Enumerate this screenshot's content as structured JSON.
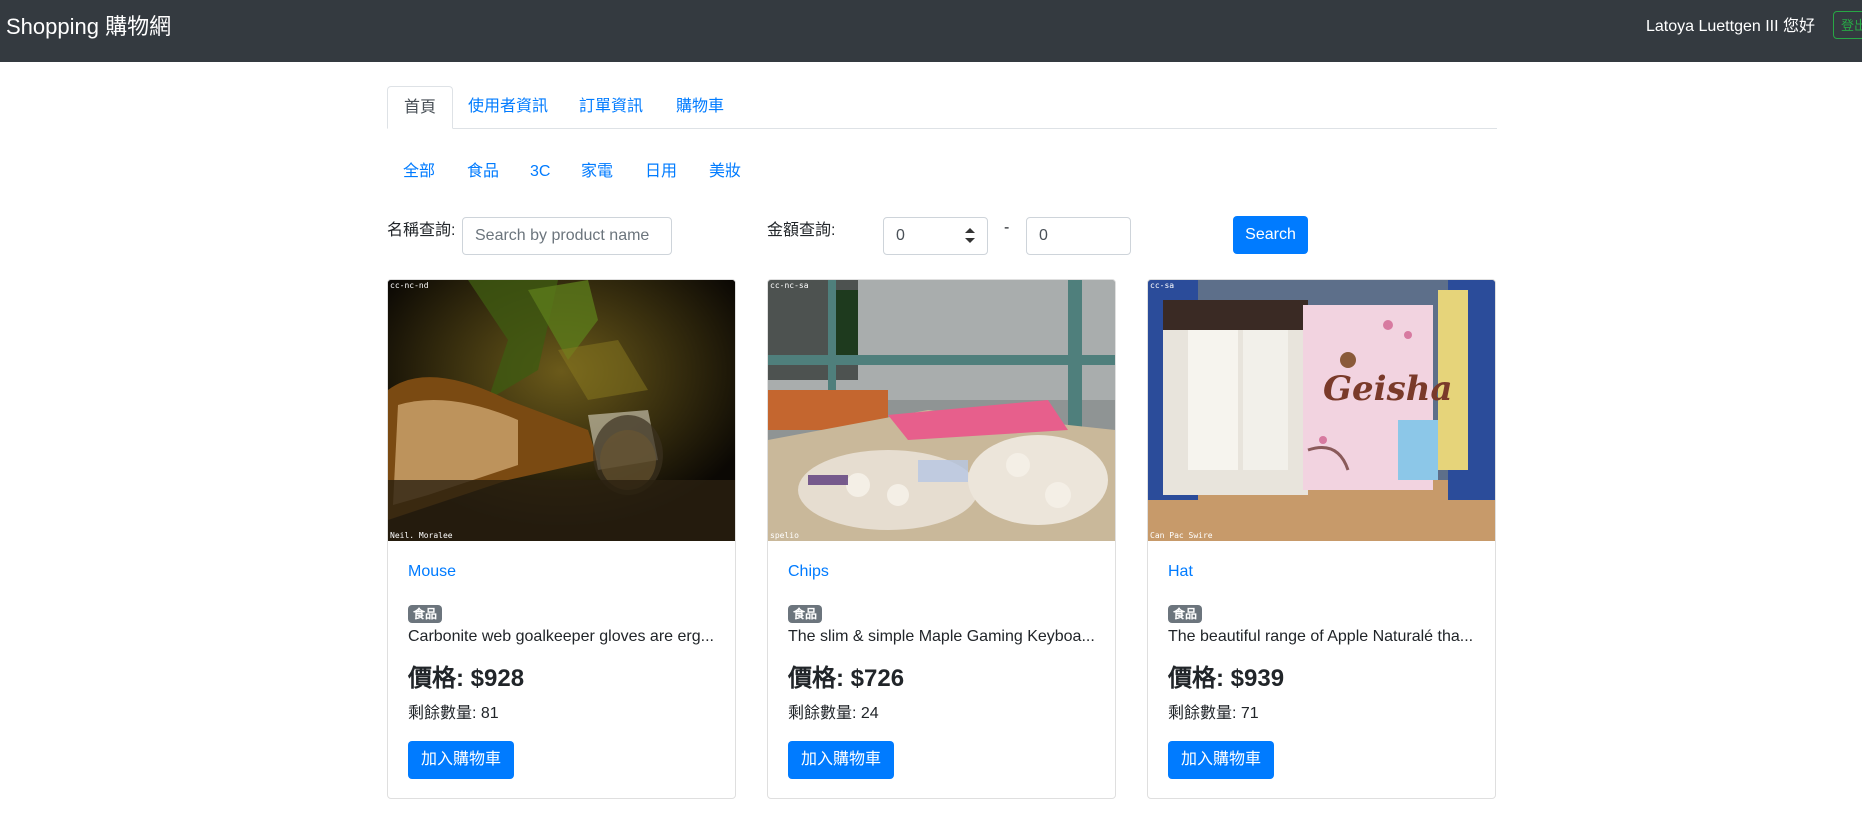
{
  "navbar": {
    "brand": "Shopping 購物網",
    "greeting": "Latoya Luettgen III 您好",
    "logout_label": "登出"
  },
  "tabs": [
    {
      "label": "首頁",
      "active": true
    },
    {
      "label": "使用者資訊",
      "active": false
    },
    {
      "label": "訂單資訊",
      "active": false
    },
    {
      "label": "購物車",
      "active": false
    }
  ],
  "categories": [
    "全部",
    "食品",
    "3C",
    "家電",
    "日用",
    "美妝"
  ],
  "search": {
    "name_label": "名稱查詢:",
    "name_placeholder": "Search by product name",
    "price_label": "金額查詢:",
    "min_value": "0",
    "separator": "-",
    "max_value": "0",
    "button_label": "Search"
  },
  "products": [
    {
      "name": "Mouse",
      "category": "食品",
      "description": "Carbonite web goalkeeper gloves are erg...",
      "price": "價格: $928",
      "stock": "剩餘數量: 81",
      "button_label": "加入購物車",
      "image_credit_top": "cc-nc-nd",
      "image_credit_bottom": "Neil. Moralee"
    },
    {
      "name": "Chips",
      "category": "食品",
      "description": "The slim & simple Maple Gaming Keyboa...",
      "price": "價格: $726",
      "stock": "剩餘數量: 24",
      "button_label": "加入購物車",
      "image_credit_top": "cc-nc-sa",
      "image_credit_bottom": "spelio"
    },
    {
      "name": "Hat",
      "category": "食品",
      "description": "The beautiful range of Apple Naturalé tha...",
      "price": "價格: $939",
      "stock": "剩餘數量: 71",
      "button_label": "加入購物車",
      "image_credit_top": "cc-sa",
      "image_credit_bottom": "Can Pac Swire",
      "image_text": "Geisha"
    }
  ],
  "colors": {
    "navbar_bg": "#343a40",
    "primary": "#007bff",
    "success": "#28a745",
    "badge": "#6c757d"
  }
}
